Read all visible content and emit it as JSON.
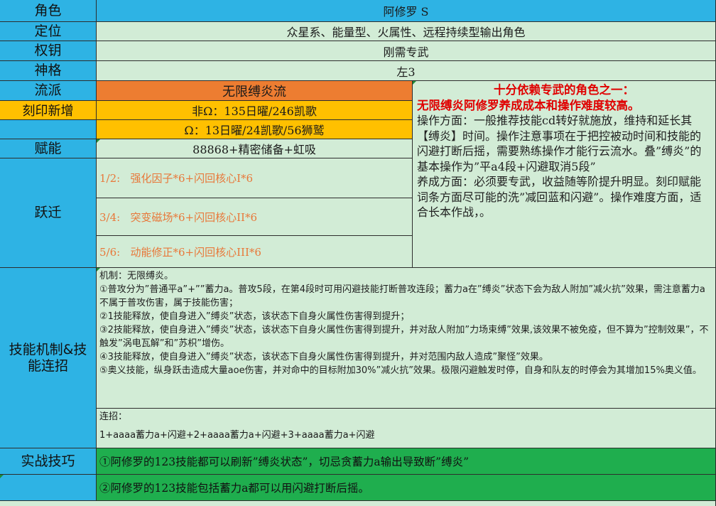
{
  "rows": {
    "role": {
      "label": "角色",
      "value": "阿修罗 S"
    },
    "position": {
      "label": "定位",
      "value": "众星系、能量型、火属性、远程持续型输出角色"
    },
    "key": {
      "label": "权钥",
      "value": "刚需专武"
    },
    "divinity": {
      "label": "神格",
      "value": "左3"
    },
    "school": {
      "label": "流派",
      "value": "无限缚炎流"
    },
    "imprint": {
      "label": "刻印新增",
      "value1": "非Ω：135日曜/246凯歌",
      "value2": "Ω：13日曜/24凯歌/56狮鹫"
    },
    "talent": {
      "label": "赋能",
      "value": "88868+精密储备+虹吸"
    },
    "leap": {
      "label": "跃迁",
      "items": [
        "1/2:   强化因子*6+闪回核心I*6",
        "3/4:   突变磁场*6+闪回核心II*6",
        "5/6:   动能修正*6+闪回核心III*6"
      ]
    },
    "skills": {
      "label": "技能机制&技能连招",
      "mechanics": [
        "机制：无限缚炎。",
        "①普攻分为”普通平a”+””蓄力a。普攻5段，在第4段时可用闪避技能打断普攻连段；蓄力a在”缚炎”状态下会为敌人附加”减火抗”效果，需注意蓄力a不属于普攻伤害，属于技能伤害；",
        "②1技能释放，使自身进入”缚炎”状态，该状态下自身火属性伤害得到提升；",
        "③2技能释放，使自身进入”缚炎”状态，该状态下自身火属性伤害得到提升，并对敌人附加”力场束缚”效果,该效果不被免疫，但不算为”控制效果”，不触发”涡电瓦解”和”苏枳”增伤。",
        "④3技能释放，使自身进入”缚炎”状态，该状态下自身火属性伤害得到提升，并对范围内敌人造成”聚怪”效果。",
        "⑤奥义技能，纵身跃击造成大量aoe伤害，并对命中的目标附加30%”减火抗”效果。极限闪避触发时停，自身和队友的时停会为其增加15%奥义值。"
      ],
      "combo_title": "连招：",
      "combo": "1+aaaa蓄力a+闪避+2+aaaa蓄力a+闪避+3+aaaa蓄力a+闪避"
    },
    "practice": {
      "label": "实战技巧",
      "tips": [
        "①阿修罗的123技能都可以刷新”缚炎状态”，切忌贪蓄力a输出导致断”缚炎”",
        "②阿修罗的123技能包括蓄力a都可以用闪避打断后摇。"
      ]
    }
  },
  "note": {
    "red_line1": "十分依赖专武的角色之一：",
    "red_line2": "无限缚炎阿修罗养成成本和操作难度较高。",
    "body": "操作方面：一般推荐技能cd转好就施放，维持和延长其【缚炎】时间。操作注意事项在于把控被动时间和技能的闪避打断后摇，需要熟练操作才能行云流水。叠”缚炎”的基本操作为”平a4段+闪避取消5段”\n养成方面：必须要专武，收益随等阶提升明显。刻印赋能词条方面尽可能的洗”减回蓝和闪避”。操作难度方面，适合长本作战，。"
  },
  "colors": {
    "header_label": "#2eb3e4",
    "school_fill": "#ed7d31",
    "imprint_fill": "#ffc000",
    "note_red": "#e00000",
    "tip_fill": "#1fae4e",
    "sheet_fill": "#d2ecd6"
  }
}
